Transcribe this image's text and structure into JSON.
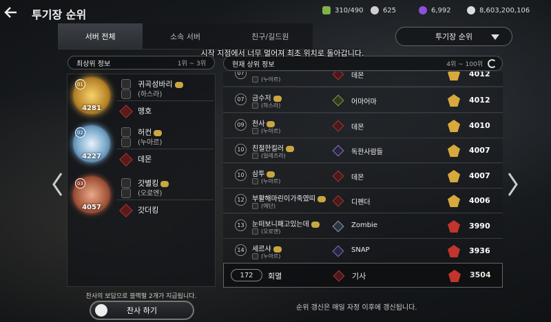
{
  "header": {
    "title": "투기장 순위"
  },
  "resources": [
    {
      "icon": "stamina-icon",
      "value": "310/490",
      "color": "#7fb247"
    },
    {
      "icon": "silver-coin-icon",
      "value": "625",
      "color": "#cfcfcf"
    },
    {
      "icon": "purple-gem-icon",
      "value": "6,992",
      "color": "#8c4fe0"
    },
    {
      "icon": "silver-icon",
      "value": "8,603,200,106",
      "color": "#d8dde2"
    }
  ],
  "tabs": [
    {
      "label": "서버 전체"
    },
    {
      "label": "소속 서버"
    },
    {
      "label": "친구/길드원"
    }
  ],
  "dropdown": {
    "selected": "투기장 순위"
  },
  "toast": "시작 지점에서 너무 멀어져 최초 위치로 돌아갑니다.",
  "top": {
    "header": "최상위 정보",
    "range": "1위 ~ 3위",
    "entries": [
      {
        "rank": "01",
        "score": "4281",
        "name": "귀곡성바리",
        "server": "(하스라)",
        "guild": "맹호",
        "color": "#d9a53a"
      },
      {
        "rank": "02",
        "score": "4227",
        "name": "허컨",
        "server": "(누아르)",
        "guild": "데몬",
        "color": "#6fa8d6"
      },
      {
        "rank": "03",
        "score": "4057",
        "name": "갓별킹",
        "server": "(오로엔)",
        "guild": "갓더킹",
        "color": "#c5644a"
      }
    ],
    "note": "찬사의 보답으로 블랙펄 2개가 지급됩니다.",
    "praise_label": "찬사 하기"
  },
  "upper": {
    "header": "현재 상위 정보",
    "range": "4위 ~ 100위",
    "rows": [
      {
        "rank": "07",
        "name": "",
        "server": "(누아르)",
        "guild": "데몬",
        "score": "4012",
        "tier": "gold"
      },
      {
        "rank": "07",
        "name": "금수저",
        "server": "(하스라)",
        "guild": "어마어마",
        "score": "4012",
        "tier": "gold"
      },
      {
        "rank": "09",
        "name": "천사",
        "server": "(누아르)",
        "guild": "데몬",
        "score": "4010",
        "tier": "gold"
      },
      {
        "rank": "10",
        "name": "친절한킬러",
        "server": "(일레즈라)",
        "guild": "독한사람들",
        "score": "4007",
        "tier": "gold"
      },
      {
        "rank": "10",
        "name": "삼투",
        "server": "(누아르)",
        "guild": "데몬",
        "score": "4007",
        "tier": "gold"
      },
      {
        "rank": "12",
        "name": "부활해마린이가죽였띠",
        "server": "(에단)",
        "guild": "디펜더",
        "score": "4006",
        "tier": "gold"
      },
      {
        "rank": "13",
        "name": "눈떠보니패고있는데",
        "server": "(오로엔)",
        "guild": "Zombie",
        "score": "3990",
        "tier": "red"
      },
      {
        "rank": "14",
        "name": "세르샤",
        "server": "(누아르)",
        "guild": "SNAP",
        "score": "3936",
        "tier": "red"
      }
    ],
    "mine": {
      "rank": "172",
      "name": "회멸",
      "guild": "기사",
      "score": "3504"
    },
    "footer": "순위 갱신은 매일 자정 이후에 갱신됩니다."
  }
}
